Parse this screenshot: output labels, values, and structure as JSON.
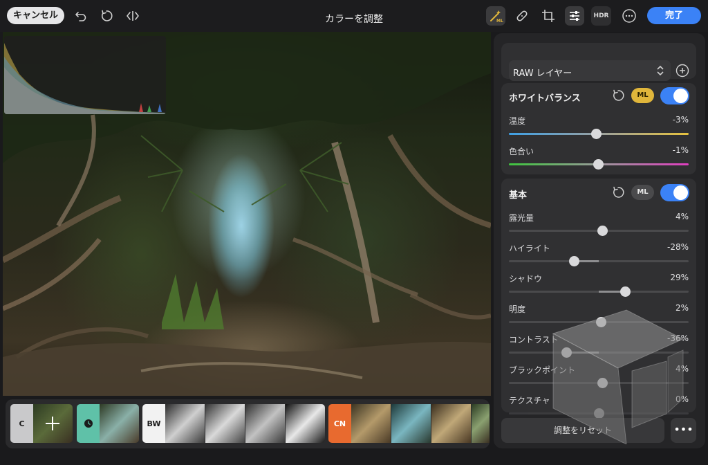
{
  "topbar": {
    "cancel_label": "キャンセル",
    "title": "カラーを調整",
    "hdr_label": "HDR",
    "done_label": "完了",
    "ml_wand_badge": "ML"
  },
  "filmstrip": {
    "groups": [
      {
        "label": "C",
        "color": "#c9c9cb",
        "text_color": "#1b1b1b"
      },
      {
        "label": "",
        "color": "#5fc1a8",
        "text_color": "#1b1b1b"
      },
      {
        "label": "BW",
        "color": "#f2f2f2",
        "text_color": "#1b1b1b"
      },
      {
        "label": "CN",
        "color": "#e86a2f",
        "text_color": "#ffffff"
      }
    ]
  },
  "panel": {
    "raw_layer_label": "RAW レイヤー",
    "white_balance": {
      "title": "ホワイトバランス",
      "ml_label": "ML",
      "enabled": true,
      "rows": [
        {
          "label": "温度",
          "value": "-3%",
          "level": -0.03
        },
        {
          "label": "色合い",
          "value": "-1%",
          "level": -0.01
        }
      ]
    },
    "basic": {
      "title": "基本",
      "ml_label": "ML",
      "enabled": true,
      "rows": [
        {
          "label": "露光量",
          "value": "4%",
          "level": 0.04
        },
        {
          "label": "ハイライト",
          "value": "-28%",
          "level": -0.28
        },
        {
          "label": "シャドウ",
          "value": "29%",
          "level": 0.29
        },
        {
          "label": "明度",
          "value": "2%",
          "level": 0.02
        },
        {
          "label": "コントラスト",
          "value": "-36%",
          "level": -0.36
        },
        {
          "label": "ブラックポイント",
          "value": "4%",
          "level": 0.04
        },
        {
          "label": "テクスチャ",
          "value": "0%",
          "level": 0.0
        }
      ]
    },
    "reset_label": "調整をリセット",
    "more_label": "•••"
  },
  "colors": {
    "accent": "#3b82f6",
    "ml_active": "#e0b63b",
    "panel_bg": "#252527"
  }
}
